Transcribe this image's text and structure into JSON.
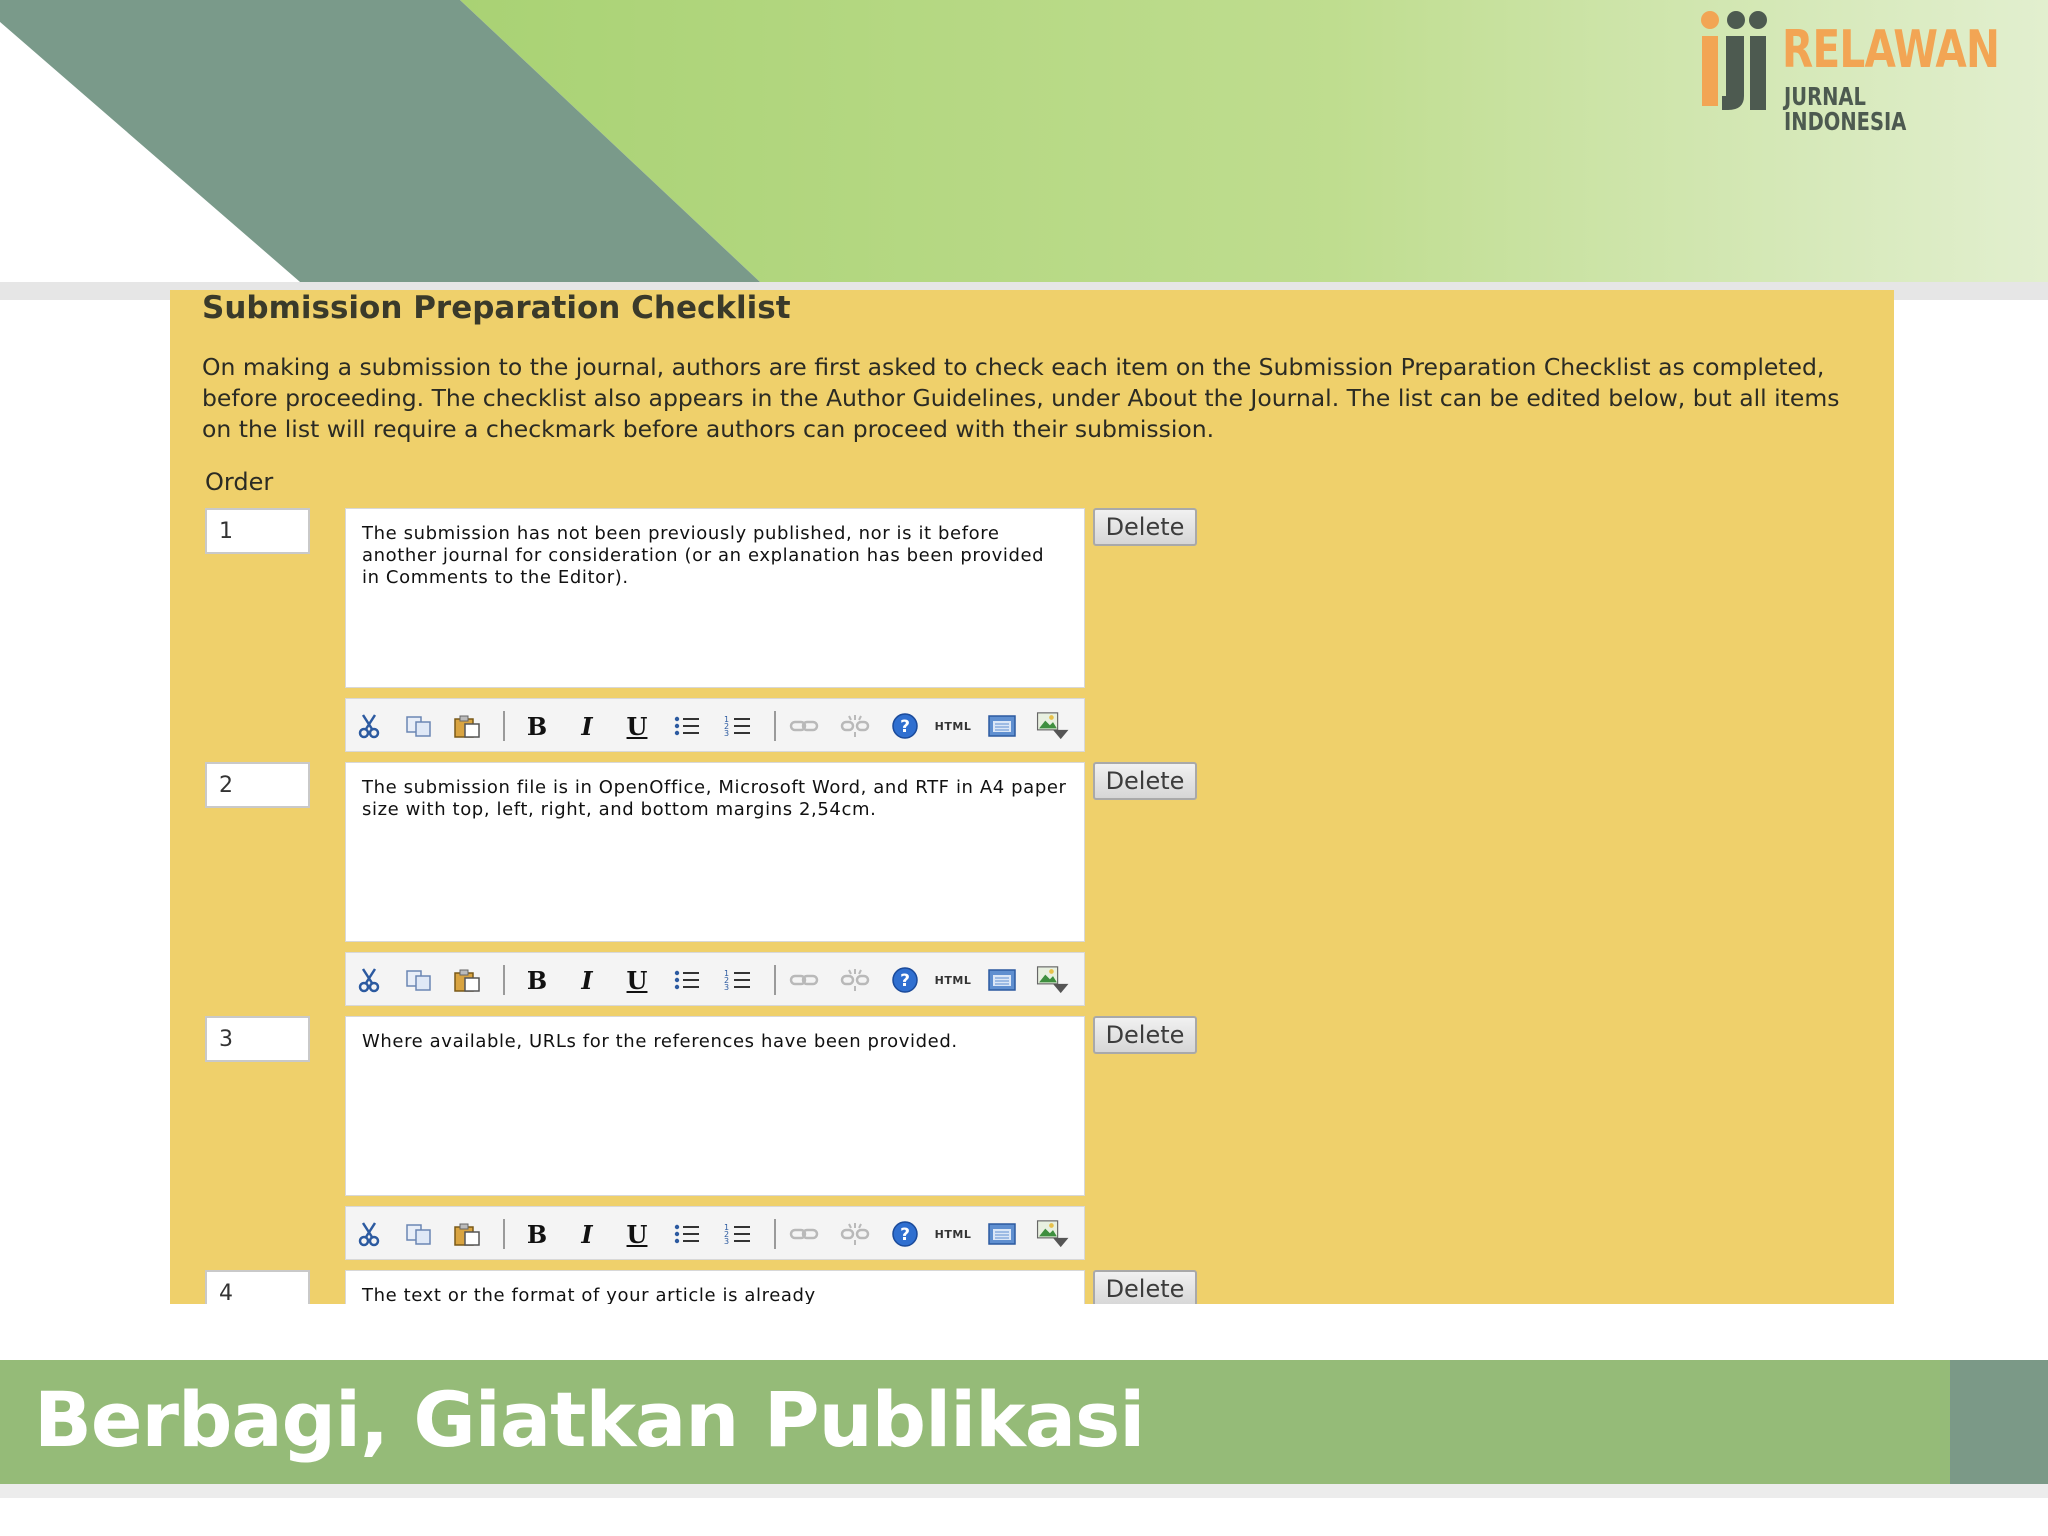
{
  "brand": {
    "logo_word_1": "RELAWAN",
    "logo_word_2": "JURNAL INDONESIA"
  },
  "colors": {
    "panel_background": "#efd06b",
    "banner_green": "#b7d98a",
    "banner_slate": "#7a9a8a",
    "footer_green": "#95bb78"
  },
  "checklist": {
    "title": "Submission Preparation Checklist",
    "description": "On making a submission to the journal, authors are first asked to check each item on the Submission Preparation Checklist as completed, before proceeding. The checklist also appears in the Author Guidelines, under About the Journal. The list can be edited below, but all items on the list will require a checkmark before authors can proceed with their submission.",
    "order_label": "Order",
    "delete_label": "Delete",
    "items": [
      {
        "order": "1",
        "text": "The submission has not been previously published, nor is it before another journal for consideration (or an explanation has been provided in Comments to the Editor)."
      },
      {
        "order": "2",
        "text": "The submission file is in OpenOffice, Microsoft Word, and RTF in A4 paper size with top, left, right, and bottom margins 2,54cm."
      },
      {
        "order": "3",
        "text": "Where available, URLs for the references have been provided."
      },
      {
        "order": "4",
        "text": "The text or the format of your article is already"
      }
    ]
  },
  "toolbar": {
    "icons": [
      "cut-icon",
      "copy-icon",
      "paste-icon",
      "bold-icon",
      "italic-icon",
      "underline-icon",
      "bullet-list-icon",
      "numbered-list-icon",
      "link-icon",
      "unlink-icon",
      "help-icon",
      "html-icon",
      "fullscreen-icon",
      "image-upload-icon"
    ],
    "bold_glyph": "B",
    "italic_glyph": "I",
    "underline_glyph": "U",
    "html_label": "HTML"
  },
  "footer": {
    "tagline": "Berbagi, Giatkan Publikasi"
  }
}
